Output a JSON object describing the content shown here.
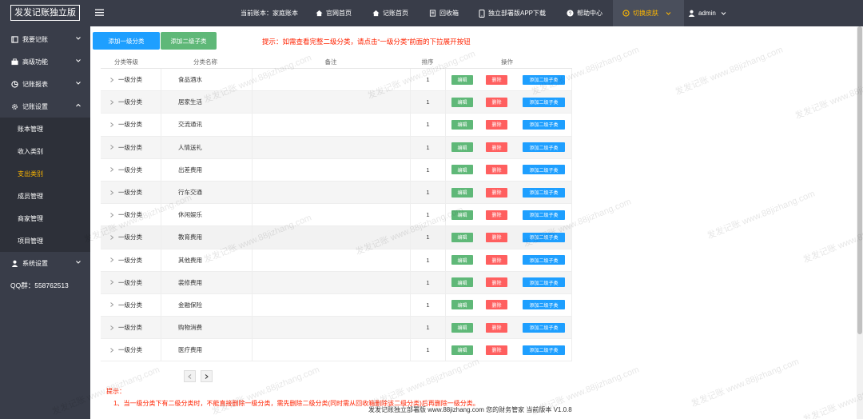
{
  "sidebar": {
    "logo": "发发记账独立版",
    "items": [
      {
        "label": "我要记账",
        "icon": "book-icon"
      },
      {
        "label": "高级功能",
        "icon": "briefcase-icon"
      },
      {
        "label": "记账报表",
        "icon": "chart-icon"
      },
      {
        "label": "记账设置",
        "icon": "gear-icon"
      }
    ],
    "sub_items": [
      "账本管理",
      "收入类别",
      "支出类别",
      "成员管理",
      "商家管理",
      "项目管理"
    ],
    "active_sub": "支出类别",
    "system": {
      "label": "系统设置",
      "icon": "user-icon"
    },
    "qq": "QQ群：558762513"
  },
  "header": {
    "current_book": "当前账本：家庭账本",
    "links": [
      "官网首页",
      "记账首页",
      "回收箱",
      "独立部署版APP下载",
      "帮助中心",
      "切换皮肤"
    ],
    "user": "admin"
  },
  "toolbar": {
    "add_level1": "添加一级分类",
    "add_level2": "添加二级子类",
    "hint": "提示：如需查看完整二级分类，请点击“一级分类”前面的下拉展开按钮"
  },
  "table": {
    "headers": [
      "分类等级",
      "分类名称",
      "备注",
      "排序",
      "操作"
    ],
    "rows": [
      {
        "level": "一级分类",
        "name": "食品酒水",
        "note": "",
        "sort": "1"
      },
      {
        "level": "一级分类",
        "name": "居家生活",
        "note": "",
        "sort": "1"
      },
      {
        "level": "一级分类",
        "name": "交流通讯",
        "note": "",
        "sort": "1"
      },
      {
        "level": "一级分类",
        "name": "人情送礼",
        "note": "",
        "sort": "1"
      },
      {
        "level": "一级分类",
        "name": "出差费用",
        "note": "",
        "sort": "1"
      },
      {
        "level": "一级分类",
        "name": "行车交通",
        "note": "",
        "sort": "1"
      },
      {
        "level": "一级分类",
        "name": "休闲娱乐",
        "note": "",
        "sort": "1"
      },
      {
        "level": "一级分类",
        "name": "教育费用",
        "note": "",
        "sort": "1"
      },
      {
        "level": "一级分类",
        "name": "其他费用",
        "note": "",
        "sort": "1"
      },
      {
        "level": "一级分类",
        "name": "装修费用",
        "note": "",
        "sort": "1"
      },
      {
        "level": "一级分类",
        "name": "金融保险",
        "note": "",
        "sort": "1"
      },
      {
        "level": "一级分类",
        "name": "购物消费",
        "note": "",
        "sort": "1"
      },
      {
        "level": "一级分类",
        "name": "医疗费用",
        "note": "",
        "sort": "1"
      }
    ],
    "actions": {
      "edit": "编辑",
      "delete": "删除",
      "add_child": "添加二级子类"
    }
  },
  "notes": {
    "title": "提示：",
    "line1": "1、当一级分类下有二级分类时，不能直接删除一级分类，需先删除二级分类(同时需从回收箱删除该二级分类)后再删除一级分类。"
  },
  "footer": "发发记账独立部署版   www.88jizhang.com   您的财务管家  当前版本 V1.0.8",
  "watermark": "发发记账 www.88jizhang.com"
}
